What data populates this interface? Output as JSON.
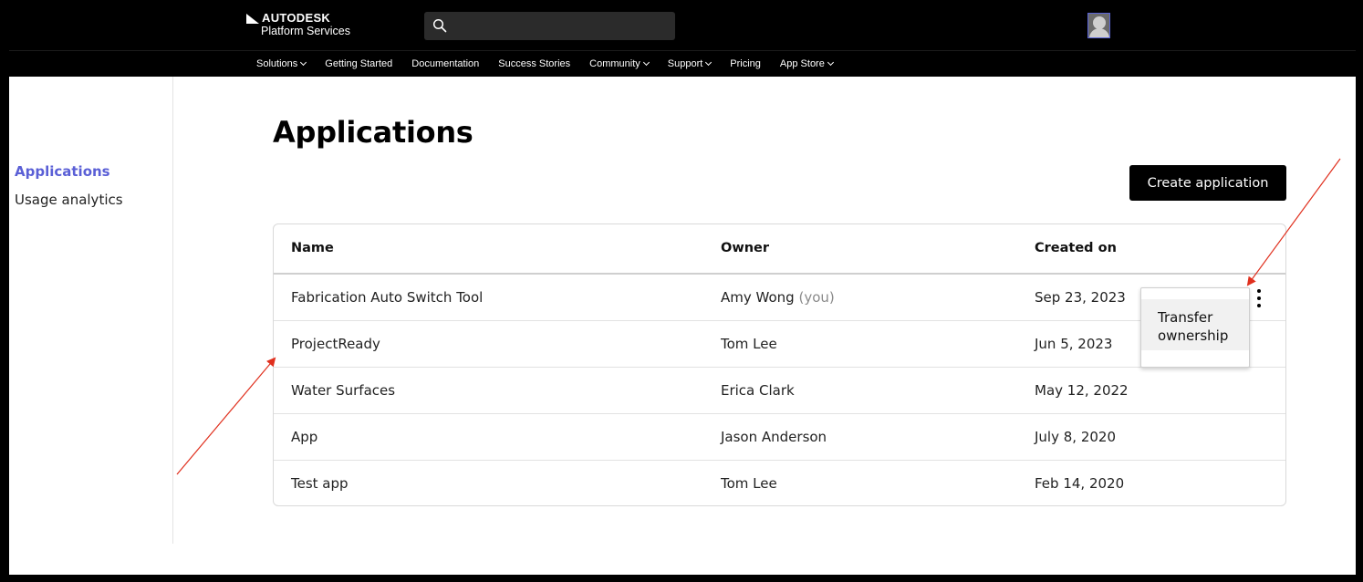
{
  "header": {
    "brand_line1": "AUTODESK",
    "brand_line2": "Platform Services",
    "search_placeholder": ""
  },
  "nav": {
    "items": [
      {
        "label": "Solutions",
        "has_dropdown": true
      },
      {
        "label": "Getting Started",
        "has_dropdown": false
      },
      {
        "label": "Documentation",
        "has_dropdown": false
      },
      {
        "label": "Success Stories",
        "has_dropdown": false
      },
      {
        "label": "Community",
        "has_dropdown": true
      },
      {
        "label": "Support",
        "has_dropdown": true
      },
      {
        "label": "Pricing",
        "has_dropdown": false
      },
      {
        "label": "App Store",
        "has_dropdown": true
      }
    ]
  },
  "sidebar": {
    "items": [
      {
        "label": "Applications",
        "active": true
      },
      {
        "label": "Usage analytics",
        "active": false
      }
    ]
  },
  "main": {
    "title": "Applications",
    "create_button": "Create application",
    "table": {
      "headers": [
        "Name",
        "Owner",
        "Created on"
      ],
      "rows": [
        {
          "name": "Fabrication Auto Switch Tool",
          "owner": "Amy Wong",
          "owner_suffix": "(you)",
          "created": "Sep 23, 2023"
        },
        {
          "name": "ProjectReady",
          "owner": "Tom Lee",
          "owner_suffix": "",
          "created": "Jun 5, 2023"
        },
        {
          "name": "Water Surfaces",
          "owner": "Erica Clark",
          "owner_suffix": "",
          "created": "May 12, 2022"
        },
        {
          "name": "App",
          "owner": "Jason Anderson",
          "owner_suffix": "",
          "created": "July 8, 2020"
        },
        {
          "name": "Test app",
          "owner": "Tom Lee",
          "owner_suffix": "",
          "created": "Feb 14, 2020"
        }
      ]
    },
    "row_menu": {
      "item_line1": "Transfer",
      "item_line2": "ownership"
    }
  },
  "colors": {
    "accent": "#5a5fd6",
    "annotation_arrow": "#e0301e",
    "header_bg": "#000000"
  }
}
